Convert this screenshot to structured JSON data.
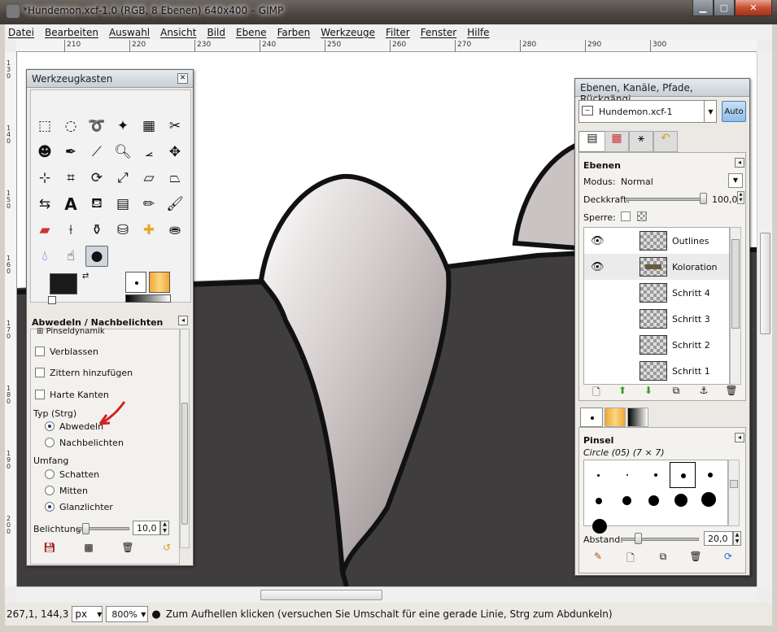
{
  "window": {
    "title": "*Hundemon.xcf-1.0 (RGB, 8 Ebenen) 640x400 – GIMP"
  },
  "menu": [
    "Datei",
    "Bearbeiten",
    "Auswahl",
    "Ansicht",
    "Bild",
    "Ebene",
    "Farben",
    "Werkzeuge",
    "Filter",
    "Fenster",
    "Hilfe"
  ],
  "ruler": {
    "h": [
      "210",
      "220",
      "230",
      "240",
      "250",
      "260",
      "270",
      "280",
      "290",
      "300"
    ],
    "v": [
      "130",
      "140",
      "150",
      "160",
      "170",
      "180",
      "190",
      "200"
    ]
  },
  "toolbox": {
    "title": "Werkzeugkasten",
    "options_title": "Abwedeln / Nachbelichten",
    "brush_dynamics_label": "Pinseldynamik",
    "fade_label": "Verblassen",
    "jitter_label": "Zittern hinzufügen",
    "hard_edges_label": "Harte Kanten",
    "type_label": "Typ (Strg)",
    "type_dodge": "Abwedeln",
    "type_burn": "Nachbelichten",
    "range_label": "Umfang",
    "range_shadows": "Schatten",
    "range_midtones": "Mitten",
    "range_highlights": "Glanzlichter",
    "exposure_label": "Belichtung:",
    "exposure_value": "10,0",
    "exposure_fraction": 0.1
  },
  "layers_dock": {
    "title": "Ebenen, Kanäle, Pfade, Rückgängi...",
    "image_select": "Hundemon.xcf-1",
    "auto_label": "Auto",
    "section_title": "Ebenen",
    "mode_label": "Modus:",
    "mode_value": "Normal",
    "opacity_label": "Deckkraft:",
    "opacity_value": "100,0",
    "opacity_fraction": 1.0,
    "lock_label": "Sperre:",
    "layers": [
      {
        "name": "Outlines",
        "visible": true
      },
      {
        "name": "Koloration",
        "visible": true
      },
      {
        "name": "Schritt 4",
        "visible": false
      },
      {
        "name": "Schritt 3",
        "visible": false
      },
      {
        "name": "Schritt 2",
        "visible": false
      },
      {
        "name": "Schritt 1",
        "visible": false
      }
    ],
    "brushes_title": "Pinsel",
    "brush_name": "Circle (05) (7 × 7)",
    "spacing_label": "Abstand:",
    "spacing_value": "20,0",
    "spacing_fraction": 0.2
  },
  "status": {
    "coords": "267,1, 144,3",
    "unit": "px",
    "zoom": "800%",
    "message": "Zum Aufhellen klicken (versuchen Sie Umschalt für eine gerade Linie, Strg zum Abdunkeln)"
  },
  "colors": {
    "foreground": "#1b1b1b",
    "background": "#ffffff",
    "accent": "#2a6fcf"
  }
}
